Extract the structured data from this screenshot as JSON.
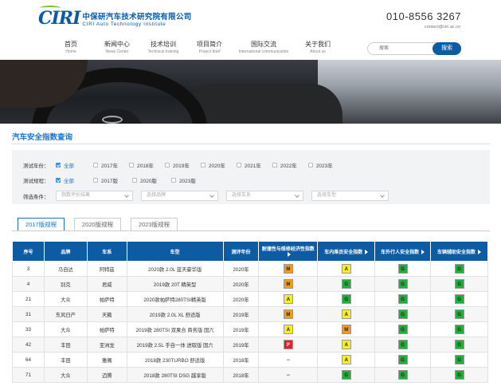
{
  "header": {
    "logo_mark": "CIRI",
    "logo_cn": "中保研汽车技术研究院有限公司",
    "logo_en": "CIRI Auto Technology Institute",
    "phone": "010-8556 3267",
    "email": "contact@ciri.ac.cn"
  },
  "nav": [
    {
      "cn": "首页",
      "en": "Home"
    },
    {
      "cn": "新闻中心",
      "en": "News Center"
    },
    {
      "cn": "技术培训",
      "en": "Technical training"
    },
    {
      "cn": "项目简介",
      "en": "Project brief"
    },
    {
      "cn": "国际交流",
      "en": "International communication"
    },
    {
      "cn": "关于我们",
      "en": "About us"
    }
  ],
  "search": {
    "placeholder": "搜索",
    "button": "搜索"
  },
  "page_title": "汽车安全指数查询",
  "filters": {
    "year_label": "测试年份：",
    "years": [
      "全部",
      "2017年",
      "2018年",
      "2019年",
      "2020年",
      "2021年",
      "2022年",
      "2023年"
    ],
    "rule_label": "测试规程：",
    "rules": [
      "全部",
      "2017版",
      "2020版",
      "2023版"
    ],
    "screen_label": "筛选条件：",
    "selects": [
      "指数评价结果",
      "选择品牌",
      "选择车系",
      "选择车型"
    ]
  },
  "tabs": [
    "2017版规程",
    "2020版规程",
    "2023版规程"
  ],
  "table": {
    "headers": [
      "序号",
      "品牌",
      "车系",
      "车型",
      "测评年份",
      "耐撞性与维修经济性指数",
      "车内乘员安全指数",
      "车外行人安全指数",
      "车辆辅助安全指数"
    ],
    "rows": [
      {
        "no": "3",
        "brand": "马自达",
        "series": "阿特兹",
        "model": "2020款 2.0L 蓝天豪华版",
        "year": "2020年",
        "r1": "M",
        "r2": "A",
        "r3": "G",
        "r4": "G"
      },
      {
        "no": "4",
        "brand": "别克",
        "series": "君威",
        "model": "2019款 20T 精英型",
        "year": "2020年",
        "r1": "M",
        "r2": "G",
        "r3": "G",
        "r4": "G"
      },
      {
        "no": "21",
        "brand": "大众",
        "series": "帕萨特",
        "model": "2020款帕萨特280TSI精英版",
        "year": "2020年",
        "r1": "A",
        "r2": "G",
        "r3": "G",
        "r4": "G"
      },
      {
        "no": "31",
        "brand": "东风日产",
        "series": "天籁",
        "model": "2019款 2.0L XL 舒适版",
        "year": "2019年",
        "r1": "M",
        "r2": "A",
        "r3": "G",
        "r4": "G"
      },
      {
        "no": "33",
        "brand": "大众",
        "series": "帕萨特",
        "model": "2019款 280TSI 双果合 商务版 国六",
        "year": "2019年",
        "r1": "A",
        "r2": "M",
        "r3": "G",
        "r4": "G"
      },
      {
        "no": "42",
        "brand": "丰田",
        "series": "亚洲龙",
        "model": "2019款 2.5L 手自一体 进取版 国六",
        "year": "2019年",
        "r1": "P",
        "r2": "A",
        "r3": "G",
        "r4": "G"
      },
      {
        "no": "64",
        "brand": "丰田",
        "series": "雅阁",
        "model": "2018款 230TURBO 舒适版",
        "year": "2018年",
        "r1": "--",
        "r2": "A",
        "r3": "G",
        "r4": "G"
      },
      {
        "no": "71",
        "brand": "大众",
        "series": "迈腾",
        "model": "2018款 280TSI DSG 越享版",
        "year": "2018年",
        "r1": "--",
        "r2": "G",
        "r3": "G",
        "r4": "G"
      }
    ]
  },
  "colors": {
    "brand_blue": "#0d5ba3",
    "G": "#1fae3a",
    "A": "#f8ec2a",
    "M": "#f39a1d",
    "P": "#e0202a"
  }
}
